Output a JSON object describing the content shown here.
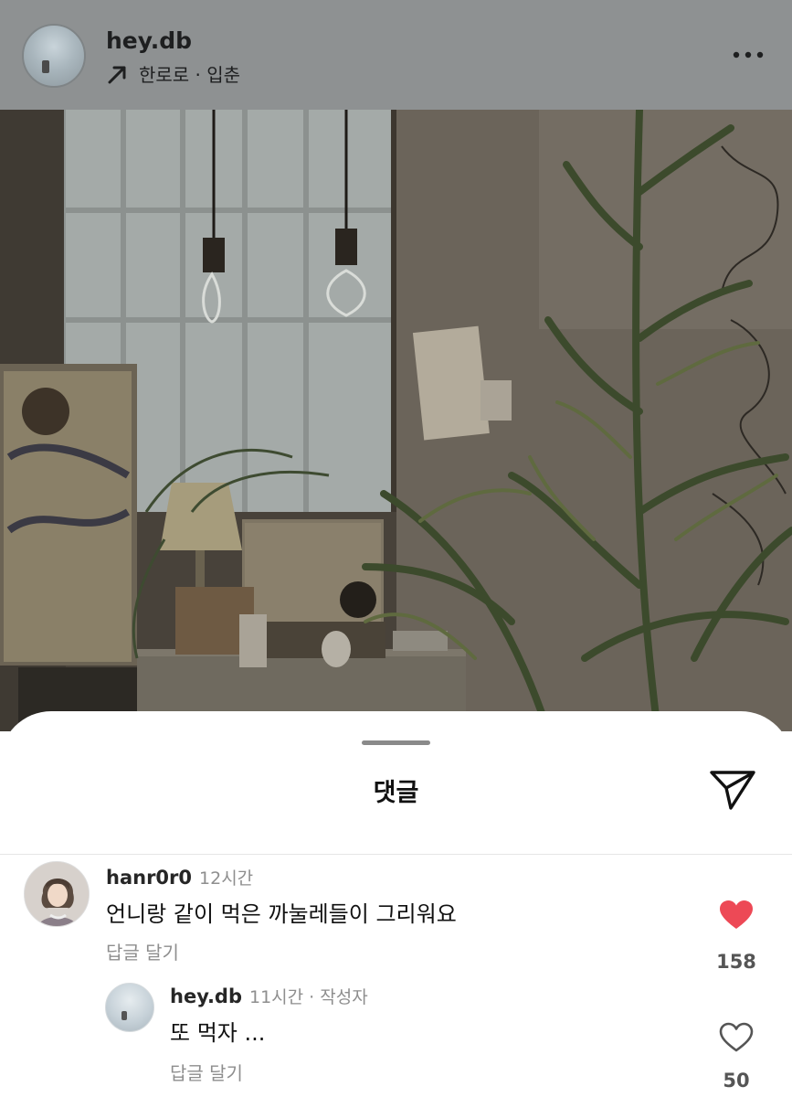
{
  "post": {
    "username": "hey.db",
    "location": "한로로 · 입춘",
    "more_icon": "more-horizontal-icon",
    "location_icon": "arrow-up-right-icon"
  },
  "sheet": {
    "title": "댓글",
    "share_icon": "send-paper-plane-icon"
  },
  "comments": [
    {
      "username": "hanr0r0",
      "time": "12시간",
      "text": "언니랑 같이 먹은 까눌레들이 그리워요",
      "reply_label": "답글 달기",
      "likes": "158",
      "liked": true
    },
    {
      "username": "hey.db",
      "time": "11시간 · 작성자",
      "text": "또 먹자 ...",
      "reply_label": "답글 달기",
      "likes": "50",
      "liked": false
    }
  ],
  "colors": {
    "like_red": "#ed4956",
    "dim_overlay": "#8e9192"
  }
}
